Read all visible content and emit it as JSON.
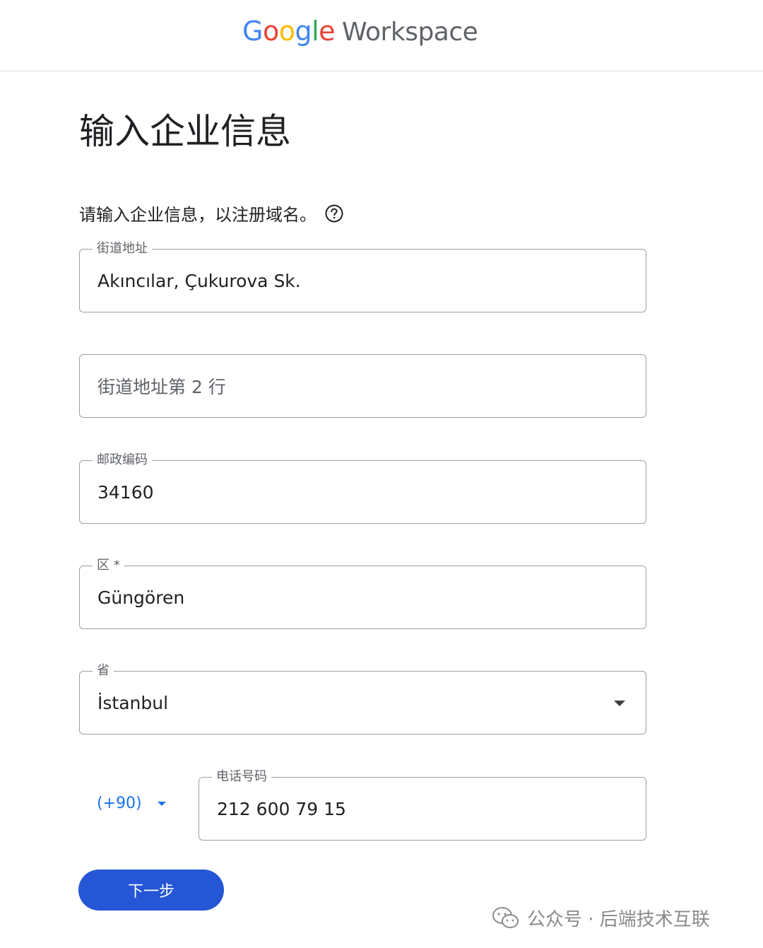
{
  "header": {
    "logo_letters": [
      {
        "char": "G",
        "color": "#4285F4"
      },
      {
        "char": "o",
        "color": "#EA4335"
      },
      {
        "char": "o",
        "color": "#FBBC05"
      },
      {
        "char": "g",
        "color": "#4285F4"
      },
      {
        "char": "l",
        "color": "#34A853"
      },
      {
        "char": "e",
        "color": "#EA4335"
      }
    ],
    "product": "Workspace"
  },
  "page": {
    "title": "输入企业信息",
    "intro": "请输入企业信息，以注册域名。",
    "help_icon": "help-circle-icon"
  },
  "form": {
    "street": {
      "label": "街道地址",
      "value": "Akıncılar, Çukurova Sk."
    },
    "street2": {
      "placeholder": "街道地址第 2 行",
      "value": ""
    },
    "postal": {
      "label": "邮政编码",
      "value": "34160"
    },
    "district": {
      "label": "区 *",
      "value": "Güngören"
    },
    "province": {
      "label": "省",
      "value": "İstanbul",
      "icon": "dropdown-arrow-icon"
    },
    "phone": {
      "country_code": "(+90)",
      "label": "电话号码",
      "value": "212 600 79 15"
    }
  },
  "actions": {
    "next_label": "下一步"
  },
  "watermark": {
    "text": "公众号 · 后端技术互联",
    "icon": "wechat-icon"
  },
  "colors": {
    "accent": "#1a73e8",
    "button": "#2456d6",
    "border": "#9aa0a6",
    "divider": "#dadce0"
  }
}
